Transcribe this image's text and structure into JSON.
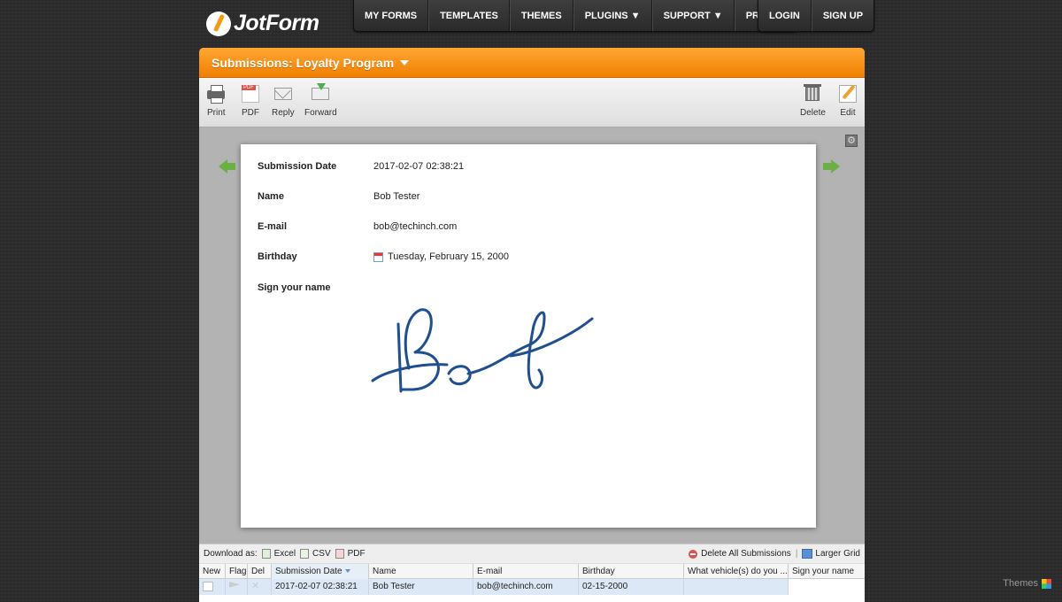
{
  "logo": {
    "text": "JotForm"
  },
  "nav": {
    "main": [
      "MY FORMS",
      "TEMPLATES",
      "THEMES",
      "PLUGINS ▼",
      "SUPPORT ▼",
      "PRICING"
    ],
    "auth": [
      "LOGIN",
      "SIGN UP"
    ]
  },
  "panel": {
    "title": "Submissions: Loyalty Program",
    "toolbar": {
      "print": "Print",
      "pdf": "PDF",
      "reply": "Reply",
      "forward": "Forward",
      "delete": "Delete",
      "edit": "Edit"
    }
  },
  "submission": {
    "fields": [
      {
        "label": "Submission Date",
        "value": "2017-02-07 02:38:21"
      },
      {
        "label": "Name",
        "value": "Bob Tester"
      },
      {
        "label": "E-mail",
        "value": "bob@techinch.com"
      },
      {
        "label": "Birthday",
        "value": "Tuesday, February 15, 2000"
      },
      {
        "label": "Sign your name",
        "value": ""
      }
    ]
  },
  "grid": {
    "download_label": "Download as:",
    "excel": "Excel",
    "csv": "CSV",
    "pdf": "PDF",
    "delete_all": "Delete All Submissions",
    "larger_grid": "Larger Grid",
    "columns": [
      "New",
      "Flag",
      "Del",
      "Submission Date",
      "Name",
      "E-mail",
      "Birthday",
      "What vehicle(s) do you ...",
      "Sign your name"
    ],
    "rows": [
      {
        "submission_date": "2017-02-07 02:38:21",
        "name": "Bob Tester",
        "email": "bob@techinch.com",
        "birthday": "02-15-2000",
        "vehicle": ""
      }
    ]
  },
  "footer": {
    "themes": "Themes"
  },
  "colors": {
    "accent": "#f39c12",
    "header_orange": "#f08a00",
    "arrow_green": "#6bb044",
    "signature_blue": "#1f4f8f"
  }
}
